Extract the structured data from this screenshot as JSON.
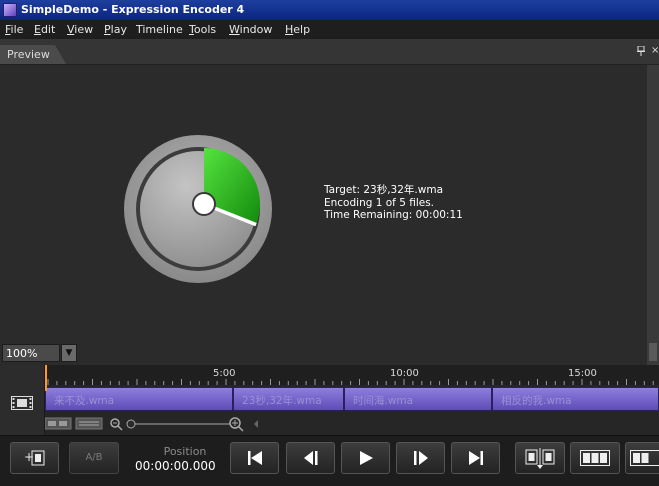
{
  "window": {
    "title": "SimpleDemo - Expression Encoder 4"
  },
  "menu": [
    {
      "label": "File",
      "underline": "F",
      "rest": "ile"
    },
    {
      "label": "Edit",
      "underline": "E",
      "rest": "dit"
    },
    {
      "label": "View",
      "underline": "V",
      "rest": "iew"
    },
    {
      "label": "Play",
      "underline": "P",
      "rest": "lay"
    },
    {
      "label": "Timeline",
      "underline": "",
      "rest": "Timeline"
    },
    {
      "label": "Tools",
      "underline": "T",
      "rest": "ools"
    },
    {
      "label": "Window",
      "underline": "W",
      "rest": "indow"
    },
    {
      "label": "Help",
      "underline": "H",
      "rest": "elp"
    }
  ],
  "panel": {
    "tab_label": "Preview",
    "close_glyph": "×"
  },
  "encoding": {
    "progress_fraction": 0.31,
    "line1": "Target: 23秒,32年.wma",
    "line2": "Encoding 1 of 5 files.",
    "line3": "Time Remaining: 00:00:11"
  },
  "zoom": {
    "value": "100%",
    "dropdown_glyph": "▼"
  },
  "timeline": {
    "ticks": [
      "5:00",
      "10:00",
      "15:00"
    ],
    "clips": [
      "来不及.wma",
      "23秒,32年.wma",
      "时间海.wma",
      "相反的我.wma"
    ]
  },
  "transport": {
    "ab_label": "A/B",
    "position_label": "Position",
    "position_value": "00:00:00.000"
  },
  "colors": {
    "progress_green": "#21b01a",
    "clip_purple": "#7565cc",
    "playhead": "#ff9a1e",
    "title_bar": "#0a2580"
  }
}
